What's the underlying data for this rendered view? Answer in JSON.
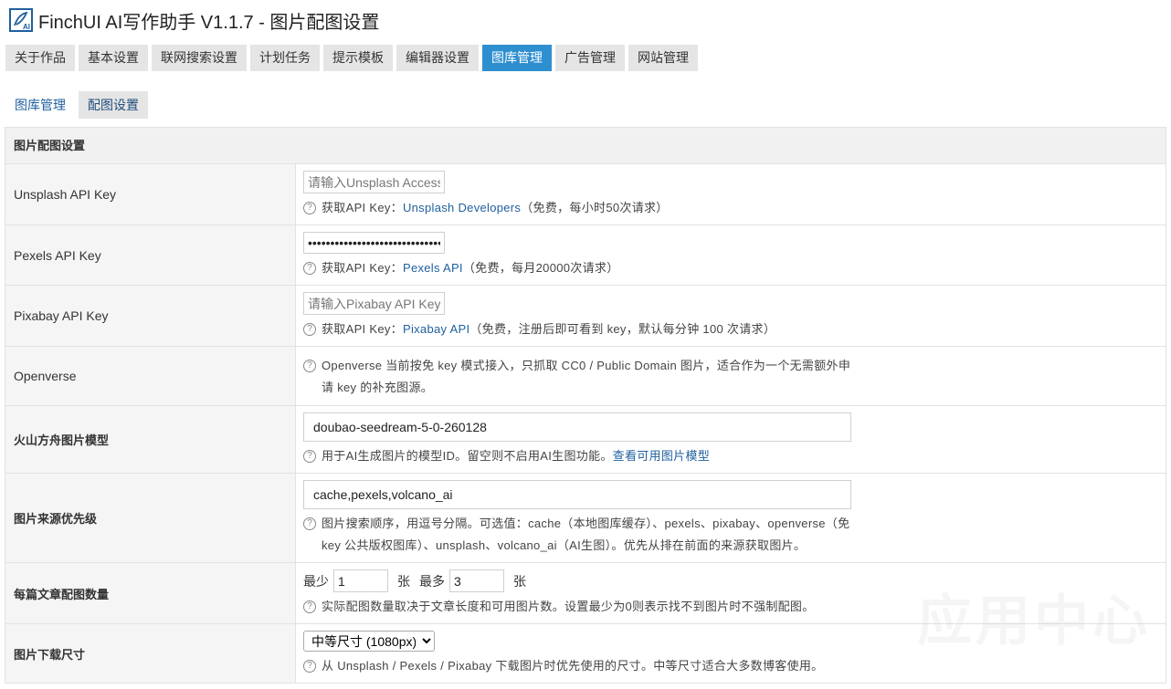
{
  "header": {
    "title": "FinchUI AI写作助手 V1.1.7 - 图片配图设置"
  },
  "main_tabs": [
    {
      "label": "关于作品"
    },
    {
      "label": "基本设置"
    },
    {
      "label": "联网搜索设置"
    },
    {
      "label": "计划任务"
    },
    {
      "label": "提示模板"
    },
    {
      "label": "编辑器设置"
    },
    {
      "label": "图库管理"
    },
    {
      "label": "广告管理"
    },
    {
      "label": "网站管理"
    }
  ],
  "active_main_tab": "图库管理",
  "sub_tabs": [
    {
      "label": "图库管理"
    },
    {
      "label": "配图设置"
    }
  ],
  "section_title": "图片配图设置",
  "rows": {
    "unsplash": {
      "label": "Unsplash API Key",
      "placeholder": "请输入Unsplash Access Key",
      "hint_prefix": "获取API Key：",
      "hint_link": "Unsplash Developers",
      "hint_suffix": "（免费，每小时50次请求）"
    },
    "pexels": {
      "label": "Pexels API Key",
      "value": "••••••••••••••••••••••••••••••••",
      "hint_prefix": "获取API Key：",
      "hint_link": "Pexels API",
      "hint_suffix": "（免费，每月20000次请求）"
    },
    "pixabay": {
      "label": "Pixabay API Key",
      "placeholder": "请输入Pixabay API Key",
      "hint_prefix": "获取API Key：",
      "hint_link": "Pixabay API",
      "hint_suffix": "（免费，注册后即可看到 key，默认每分钟 100 次请求）"
    },
    "openverse": {
      "label": "Openverse",
      "hint": "Openverse 当前按免 key 模式接入，只抓取 CC0 / Public Domain 图片，适合作为一个无需额外申请 key 的补充图源。"
    },
    "volcano": {
      "label": "火山方舟图片模型",
      "value": "doubao-seedream-5-0-260128",
      "hint_prefix": "用于AI生成图片的模型ID。留空则不启用AI生图功能。",
      "hint_link": "查看可用图片模型"
    },
    "priority": {
      "label": "图片来源优先级",
      "value": "cache,pexels,volcano_ai",
      "hint": "图片搜索顺序，用逗号分隔。可选值：cache（本地图库缓存）、pexels、pixabay、openverse（免key 公共版权图库）、unsplash、volcano_ai（AI生图）。优先从排在前面的来源获取图片。"
    },
    "count": {
      "label": "每篇文章配图数量",
      "min_label": "最少",
      "min_value": "1",
      "unit1": "张",
      "max_label": "最多",
      "max_value": "3",
      "unit2": "张",
      "hint": "实际配图数量取决于文章长度和可用图片数。设置最少为0则表示找不到图片时不强制配图。"
    },
    "size": {
      "label": "图片下载尺寸",
      "selected": "中等尺寸 (1080px)",
      "hint": "从 Unsplash / Pexels / Pixabay 下载图片时优先使用的尺寸。中等尺寸适合大多数博客使用。"
    }
  },
  "watermark": "应用中心",
  "colors": {
    "accent": "#2e8fd0",
    "link": "#1f5f9e",
    "tab_bg": "#e5e5e5",
    "label_bg": "#f5f5f5"
  }
}
